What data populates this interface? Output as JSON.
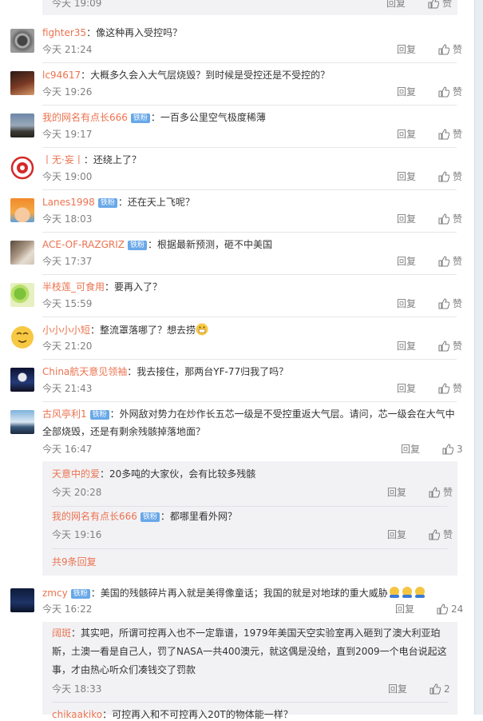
{
  "actions": {
    "reply": "回复",
    "like": "赞"
  },
  "top_partial": {
    "time": "今天 19:09"
  },
  "comments": [
    {
      "user": "fighter35",
      "text": "：像这种再入受控吗？",
      "time": "今天 21:24"
    },
    {
      "user": "lc94617",
      "text": "：大概多久会入大气层烧毁？到时候是受控还是不受控的？",
      "time": "今天 19:26"
    },
    {
      "user": "我的网名有点长666",
      "badge": "铁粉",
      "text": "：一百多公里空气极度稀薄",
      "time": "今天 19:17"
    },
    {
      "user": "丨无·妄丨",
      "text": "：还绕上了？",
      "time": "今天 19:00"
    },
    {
      "user": "Lanes1998",
      "badge": "铁粉",
      "text": "：还在天上飞呢？",
      "time": "今天 18:03"
    },
    {
      "user": "ACE-OF-RAZGRIZ",
      "badge": "铁粉",
      "text": "：根据最新预测，砸不中美国",
      "time": "今天 17:37"
    },
    {
      "user": "半枝莲_可食用",
      "text": "：要再入了？",
      "time": "今天 15:59"
    },
    {
      "user": "小小小小短",
      "text": "：整流罩落哪了？想去捞",
      "time": "今天 21:20"
    },
    {
      "user": "China航天意见领袖",
      "text": "：我去接住，那两台YF-77归我了吗？",
      "time": "今天 21:43"
    }
  ],
  "long_comment": {
    "user": "古风亭利1",
    "badge": "铁粉",
    "text_line1": "：外网敌对势力在炒作长五芯一级是不受控重返大气层。请问，芯一级会在大气中",
    "text_line2": "全部烧毁，还是有剩余残骸掉落地面？",
    "time": "今天 16:47",
    "likes": "3",
    "replies": [
      {
        "user": "天意中的爱",
        "text": "：20多吨的大家伙，会有比较多残骸",
        "time": "今天 20:28"
      },
      {
        "user": "我的网名有点长666",
        "badge": "铁粉",
        "text": "：都哪里看外网？",
        "time": "今天 19:16"
      }
    ],
    "more": "共9条回复"
  },
  "zmcy_comment": {
    "user": "zmcy",
    "badge": "铁粉",
    "text": "：美国的残骸碎片再入就是美得像童话；我国的就是对地球的重大威胁",
    "time": "今天 16:22",
    "likes": "24",
    "reply": {
      "user": "阔斑",
      "text_line1": "：其实吧，所谓可控再入也不一定靠谱，1979年美国天空实验室再入砸到了澳大利亚珀",
      "text_line2": "斯，土澳一看是自己人，罚了NASA一共400澳元，就这偶是没给，直到2009一个电台说起这",
      "text_line3": "事，才由热心听众们凑钱交了罚款",
      "time": "今天 18:33",
      "likes": "2"
    },
    "next_partial": {
      "user": "chikaakiko",
      "text": "：可控再入和不可控再入20T的物体能一样？"
    }
  }
}
